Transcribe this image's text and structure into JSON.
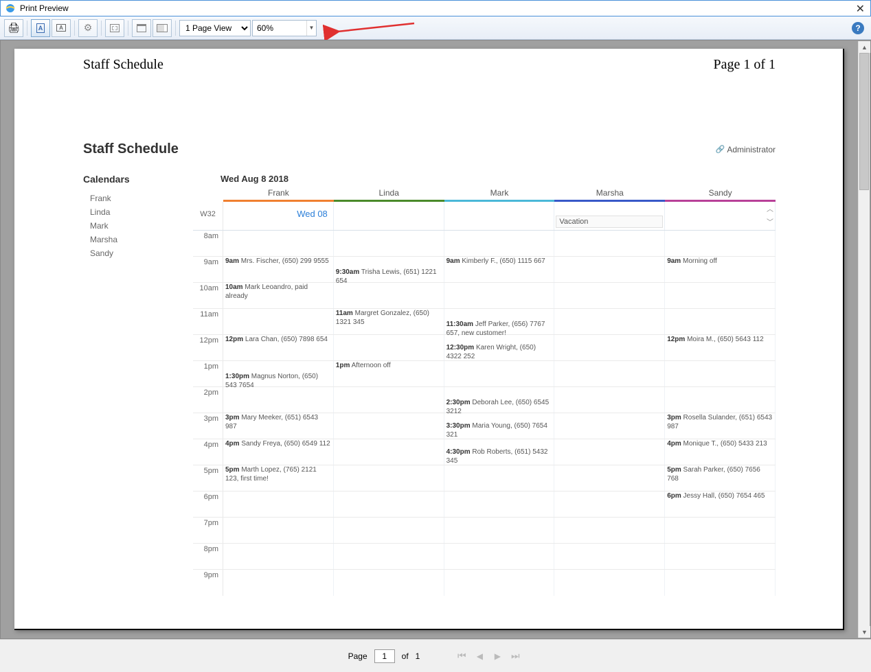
{
  "window": {
    "title": "Print Preview"
  },
  "toolbar": {
    "page_view": "1 Page View",
    "zoom": "60%"
  },
  "pageHeader": {
    "left": "Staff Schedule",
    "right": "Page 1 of 1"
  },
  "doc": {
    "title": "Staff Schedule",
    "admin": "Administrator",
    "calendars_label": "Calendars",
    "calendars": [
      "Frank",
      "Linda",
      "Mark",
      "Marsha",
      "Sandy"
    ],
    "date": "Wed Aug 8 2018",
    "week": "W32",
    "wed": "Wed 08",
    "staff": {
      "frank": "Frank",
      "linda": "Linda",
      "mark": "Mark",
      "marsha": "Marsha",
      "sandy": "Sandy"
    },
    "vacation": "Vacation",
    "hours": [
      "8am",
      "9am",
      "10am",
      "11am",
      "12pm",
      "1pm",
      "2pm",
      "3pm",
      "4pm",
      "5pm",
      "6pm",
      "7pm",
      "8pm",
      "9pm"
    ],
    "events": {
      "frank": {
        "9": {
          "t": "9am",
          "d": "Mrs. Fischer, (650) 299 9555"
        },
        "10": {
          "t": "10am",
          "d": "Mark Leoandro, paid already"
        },
        "12": {
          "t": "12pm",
          "d": "Lara Chan, (650) 7898 654"
        },
        "1b": {
          "t": "1:30pm",
          "d": "Magnus Norton, (650) 543 7654"
        },
        "3": {
          "t": "3pm",
          "d": "Mary Meeker, (651) 6543 987"
        },
        "4": {
          "t": "4pm",
          "d": "Sandy Freya, (650) 6549 112"
        },
        "5": {
          "t": "5pm",
          "d": "Marth Lopez, (765) 2121 123, first time!"
        }
      },
      "linda": {
        "9b": {
          "t": "9:30am",
          "d": "Trisha Lewis, (651) 1221 654"
        },
        "11": {
          "t": "11am",
          "d": "Margret Gonzalez, (650) 1321 345"
        },
        "1": {
          "t": "1pm",
          "d": "Afternoon off"
        }
      },
      "mark": {
        "9": {
          "t": "9am",
          "d": "Kimberly F., (650) 1115 667"
        },
        "11b": {
          "t": "11:30am",
          "d": "Jeff Parker, (656) 7767 657, new customer!"
        },
        "12b": {
          "t": "12:30pm",
          "d": "Karen Wright, (650) 4322 252"
        },
        "2b": {
          "t": "2:30pm",
          "d": "Deborah Lee, (650) 6545 3212"
        },
        "3b": {
          "t": "3:30pm",
          "d": "Maria Young, (650) 7654 321"
        },
        "4b": {
          "t": "4:30pm",
          "d": "Rob Roberts, (651) 5432 345"
        }
      },
      "sandy": {
        "9": {
          "t": "9am",
          "d": "Morning off"
        },
        "12": {
          "t": "12pm",
          "d": "Moira M., (650) 5643 112"
        },
        "3": {
          "t": "3pm",
          "d": "Rosella Sulander, (651) 6543 987"
        },
        "4": {
          "t": "4pm",
          "d": "Monique T., (650) 5433 213"
        },
        "5": {
          "t": "5pm",
          "d": "Sarah Parker, (650) 7656 768"
        },
        "6": {
          "t": "6pm",
          "d": "Jessy Hall, (650) 7654 465"
        }
      }
    }
  },
  "footer": {
    "page_label": "Page",
    "of": "of",
    "total": "1",
    "current": "1"
  }
}
